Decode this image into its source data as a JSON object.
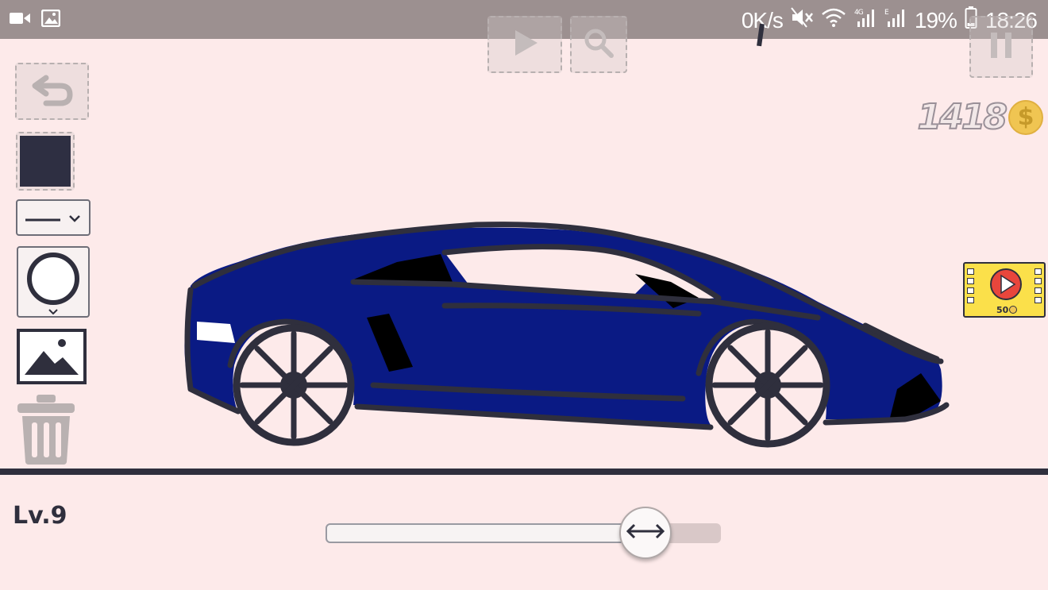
{
  "status_bar": {
    "speed": "0K/s",
    "battery": "19%",
    "time": "18:26",
    "icons": [
      "video-camera-icon",
      "gallery-icon",
      "mute-icon",
      "wifi-icon",
      "signal-4g-icon",
      "signal-e-icon",
      "battery-icon"
    ]
  },
  "toolbar": {
    "play_icon": "play-icon",
    "zoom_icon": "magnifier-icon",
    "pause_icon": "pause-icon",
    "undo_icon": "undo-icon"
  },
  "tools": {
    "color_swatch": "#2e2f42",
    "line_style": "solid",
    "brush": "circle",
    "image_icon": "image-icon",
    "trash_icon": "trash-icon"
  },
  "coins": {
    "count": "1418",
    "symbol": "$"
  },
  "video_reward": {
    "cost": "50"
  },
  "level": {
    "label": "Lv.9"
  },
  "size_slider": {
    "value": 0.81
  },
  "colors": {
    "background": "#fdeaea",
    "car_body": "#0a1a84",
    "outline": "#2f2f3d",
    "status_bar": "#9c9090"
  }
}
